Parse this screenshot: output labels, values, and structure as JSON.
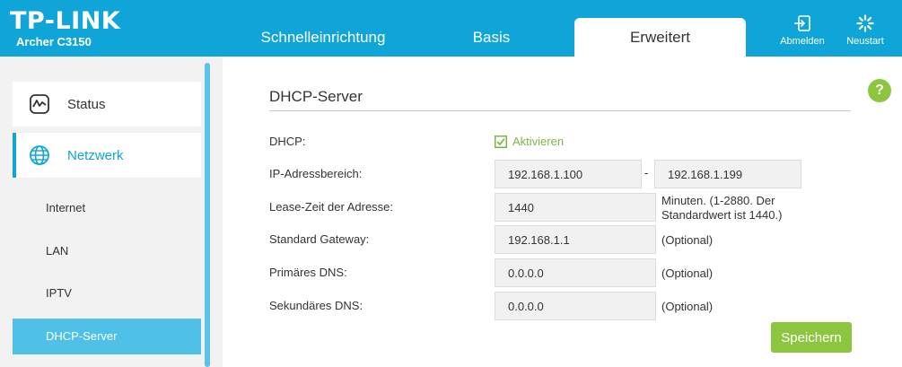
{
  "brand": {
    "logo": "TP-LINK",
    "model": "Archer C3150"
  },
  "nav": {
    "tabs": [
      {
        "label": "Schnelleinrichtung"
      },
      {
        "label": "Basis"
      },
      {
        "label": "Erweitert"
      }
    ],
    "active_tab": "Erweitert",
    "logout_label": "Abmelden",
    "reboot_label": "Neustart"
  },
  "sidebar": {
    "main_items": [
      {
        "label": "Status",
        "icon": "status-chart-icon"
      },
      {
        "label": "Netzwerk",
        "icon": "globe-icon"
      }
    ],
    "sub_items": [
      {
        "label": "Internet"
      },
      {
        "label": "LAN"
      },
      {
        "label": "IPTV"
      },
      {
        "label": "DHCP-Server"
      }
    ],
    "active_sub": "DHCP-Server"
  },
  "main": {
    "title": "DHCP-Server",
    "help_label": "?",
    "dhcp": {
      "label": "DHCP:",
      "checkbox_label": "Aktivieren",
      "checked": true
    },
    "ip_range": {
      "label": "IP-Adressbereich:",
      "start": "192.168.1.100",
      "separator": "-",
      "end": "192.168.1.199"
    },
    "lease": {
      "label": "Lease-Zeit der Adresse:",
      "value": "1440",
      "note_line1": "Minuten. (1-2880. Der",
      "note_line2": "Standardwert ist 1440.)"
    },
    "gateway": {
      "label": "Standard Gateway:",
      "value": "192.168.1.1",
      "note": "(Optional)"
    },
    "dns1": {
      "label": "Primäres DNS:",
      "value": "0.0.0.0",
      "note": "(Optional)"
    },
    "dns2": {
      "label": "Sekundäres DNS:",
      "value": "0.0.0.0",
      "note": "(Optional)"
    },
    "save_label": "Speichern"
  },
  "colors": {
    "brand_blue": "#10a5d8",
    "accent_green": "#8cc63f",
    "active_sub_bg": "#4fc1e9"
  }
}
